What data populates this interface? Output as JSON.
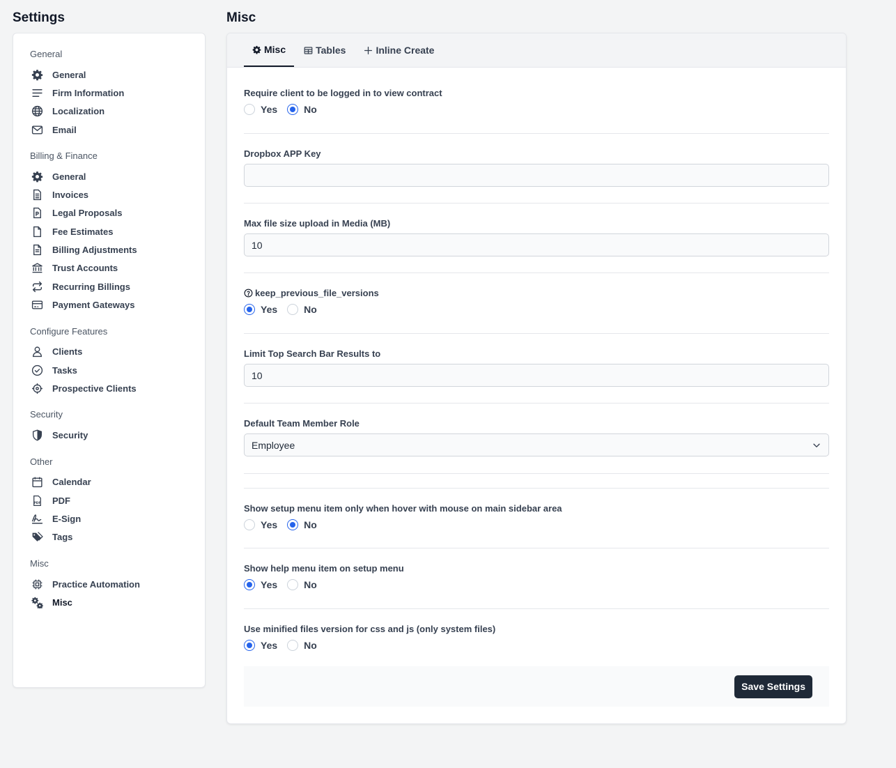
{
  "sidebar": {
    "title": "Settings",
    "groups": [
      {
        "label": "General",
        "items": [
          {
            "label": "General",
            "icon": "gear-icon"
          },
          {
            "label": "Firm Information",
            "icon": "lines-icon"
          },
          {
            "label": "Localization",
            "icon": "globe-icon"
          },
          {
            "label": "Email",
            "icon": "envelope-icon"
          }
        ]
      },
      {
        "label": "Billing & Finance",
        "items": [
          {
            "label": "General",
            "icon": "gear-icon"
          },
          {
            "label": "Invoices",
            "icon": "invoice-icon"
          },
          {
            "label": "Legal Proposals",
            "icon": "proposal-icon"
          },
          {
            "label": "Fee Estimates",
            "icon": "file-icon"
          },
          {
            "label": "Billing Adjustments",
            "icon": "file-text-icon"
          },
          {
            "label": "Trust Accounts",
            "icon": "bank-icon"
          },
          {
            "label": "Recurring Billings",
            "icon": "repeat-icon"
          },
          {
            "label": "Payment Gateways",
            "icon": "credit-card-icon"
          }
        ]
      },
      {
        "label": "Configure Features",
        "items": [
          {
            "label": "Clients",
            "icon": "user-icon"
          },
          {
            "label": "Tasks",
            "icon": "check-circle-icon"
          },
          {
            "label": "Prospective Clients",
            "icon": "crosshair-icon"
          }
        ]
      },
      {
        "label": "Security",
        "items": [
          {
            "label": "Security",
            "icon": "shield-icon"
          }
        ]
      },
      {
        "label": "Other",
        "items": [
          {
            "label": "Calendar",
            "icon": "calendar-icon"
          },
          {
            "label": "PDF",
            "icon": "pdf-icon"
          },
          {
            "label": "E-Sign",
            "icon": "signature-icon"
          },
          {
            "label": "Tags",
            "icon": "tags-icon"
          }
        ]
      },
      {
        "label": "Misc",
        "items": [
          {
            "label": "Practice Automation",
            "icon": "chip-icon"
          },
          {
            "label": "Misc",
            "icon": "gears-icon",
            "active": true
          }
        ]
      }
    ]
  },
  "main": {
    "title": "Misc",
    "tabs": [
      {
        "label": "Misc",
        "icon": "gear-icon",
        "active": true
      },
      {
        "label": "Tables",
        "icon": "table-icon"
      },
      {
        "label": "Inline Create",
        "icon": "plus-icon"
      }
    ],
    "fields": {
      "require_login": {
        "label": "Require client to be logged in to view contract",
        "yes": "Yes",
        "no": "No",
        "selected": "No"
      },
      "dropbox_key": {
        "label": "Dropbox APP Key",
        "value": ""
      },
      "max_file_size": {
        "label": "Max file size upload in Media (MB)",
        "value": "10"
      },
      "keep_versions": {
        "label": "keep_previous_file_versions",
        "yes": "Yes",
        "no": "No",
        "selected": "Yes"
      },
      "search_limit": {
        "label": "Limit Top Search Bar Results to",
        "value": "10"
      },
      "default_role": {
        "label": "Default Team Member Role",
        "value": "Employee"
      },
      "setup_hover": {
        "label": "Show setup menu item only when hover with mouse on main sidebar area",
        "yes": "Yes",
        "no": "No",
        "selected": "No"
      },
      "help_menu": {
        "label": "Show help menu item on setup menu",
        "yes": "Yes",
        "no": "No",
        "selected": "Yes"
      },
      "minified": {
        "label": "Use minified files version for css and js (only system files)",
        "yes": "Yes",
        "no": "No",
        "selected": "Yes"
      }
    },
    "save_label": "Save Settings"
  },
  "colors": {
    "accent": "#2563eb",
    "button": "#1f2937",
    "background": "#f3f4f5"
  }
}
